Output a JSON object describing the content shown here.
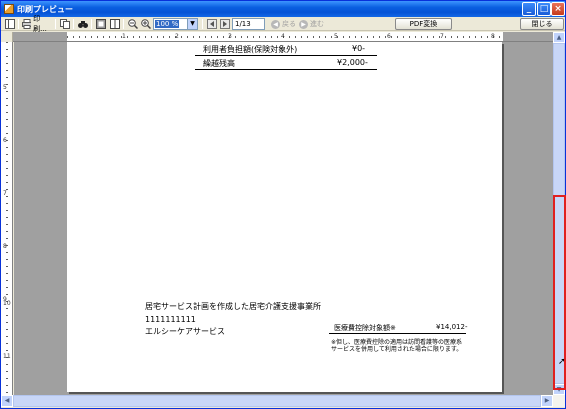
{
  "window": {
    "title": "印刷プレビュー"
  },
  "toolbar": {
    "print_label": "印刷...",
    "zoom_value": "100 %",
    "page_value": "1/13",
    "prev_label": "戻る",
    "next_label": "進む",
    "pdf_label": "PDF変換",
    "close_label": "閉じる"
  },
  "ruler": {
    "top_ticks": [
      "1",
      "2",
      "3",
      "4",
      "5",
      "6",
      "7",
      "8"
    ],
    "left_ticks": [
      "5",
      "6",
      "7",
      "8",
      "9",
      "10",
      "11"
    ]
  },
  "document": {
    "top_rows": [
      {
        "label": "利用者負担額(保険対象外)",
        "value": "¥0-"
      },
      {
        "label": "繰越残高",
        "value": "¥2,000-"
      }
    ],
    "provider_heading": "居宅サービス計画を作成した居宅介護支援事業所",
    "provider_number": "1111111111",
    "provider_name": "エルシーケアサービス",
    "deduction_label": "医療費控除対象額※",
    "deduction_value": "¥14,012-",
    "note_line1": "※但し、医療費控除の適用は訪問看護等の医療系",
    "note_line2": "サービスを併用して利用された場合に限ります。"
  },
  "colors": {
    "title_bar": "#0553d6",
    "highlight": "#e02020",
    "page_bg": "#a0a0a0"
  }
}
